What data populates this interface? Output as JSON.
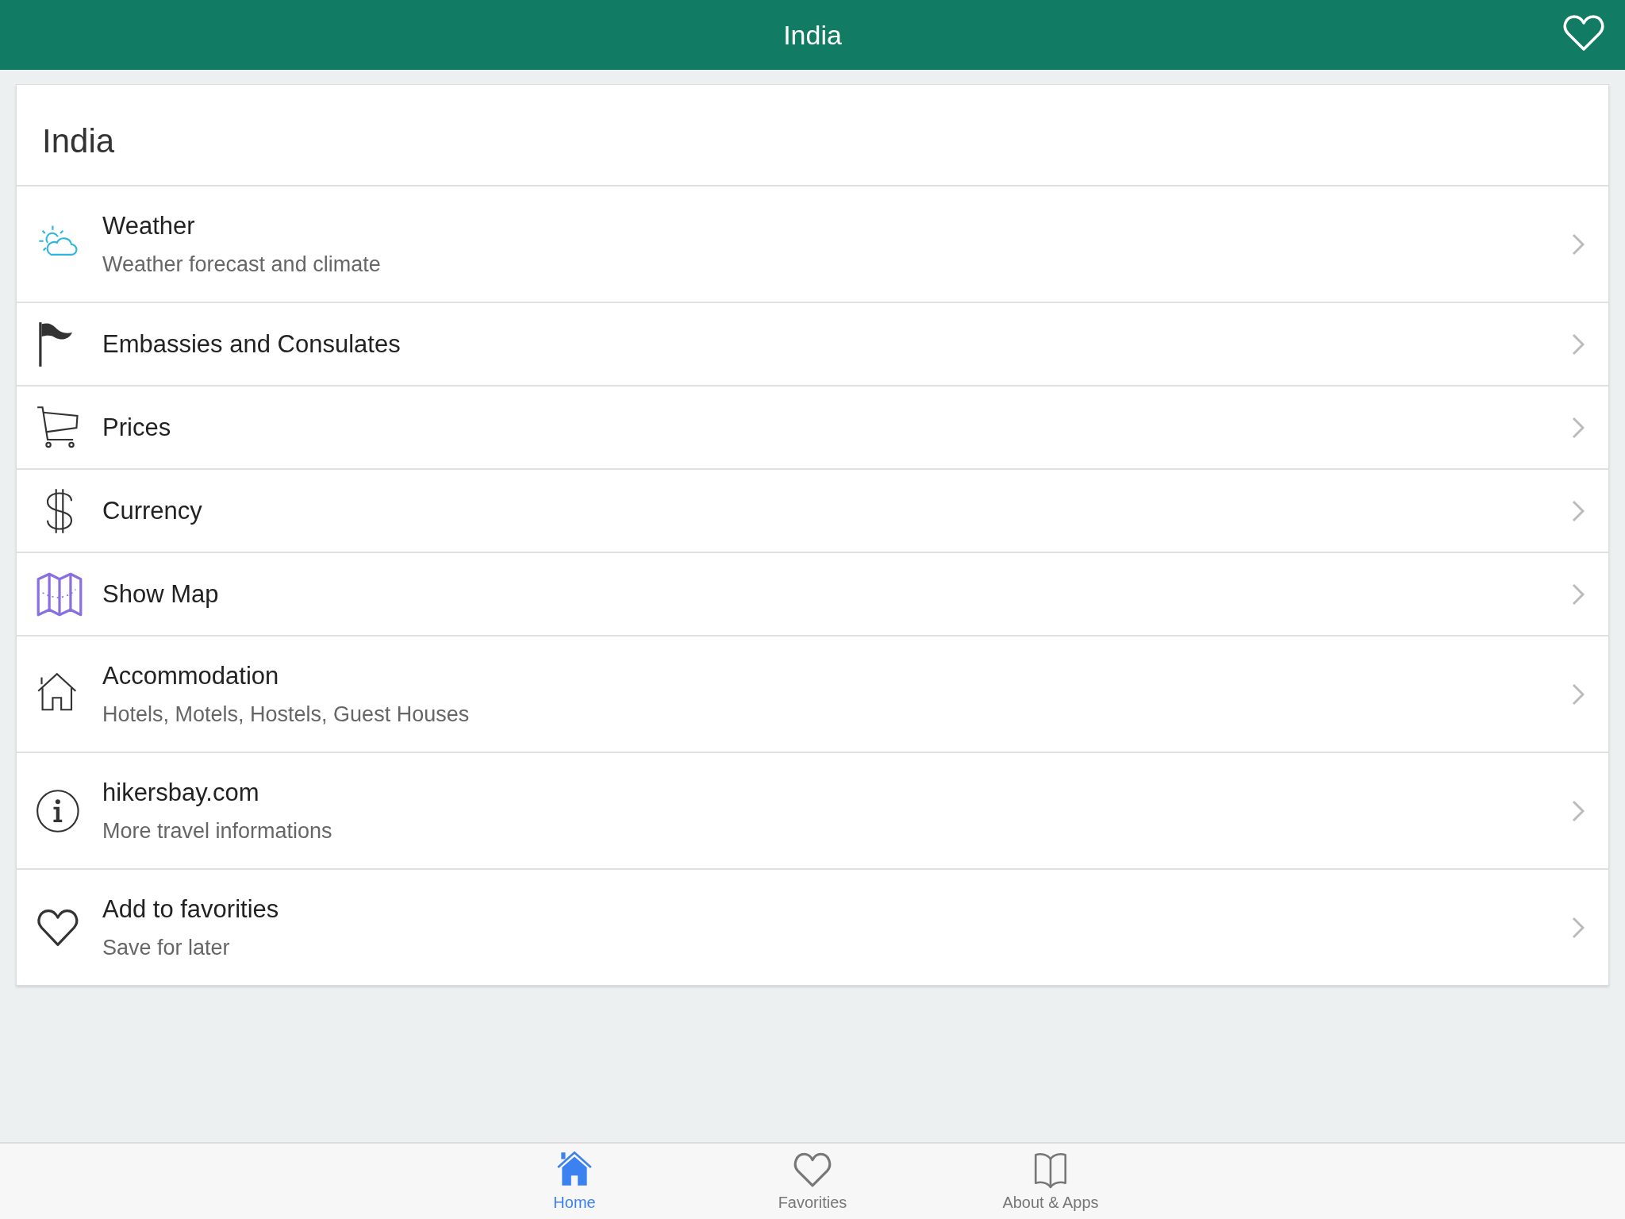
{
  "header": {
    "title": "India"
  },
  "card": {
    "title": "India",
    "items": [
      {
        "kind": "weather",
        "title": "Weather",
        "subtitle": "Weather forecast and climate"
      },
      {
        "kind": "flag",
        "title": "Embassies and Consulates"
      },
      {
        "kind": "cart",
        "title": "Prices"
      },
      {
        "kind": "dollar",
        "title": "Currency"
      },
      {
        "kind": "map",
        "title": "Show Map"
      },
      {
        "kind": "house",
        "title": "Accommodation",
        "subtitle": "Hotels, Motels, Hostels, Guest Houses"
      },
      {
        "kind": "info",
        "title": "hikersbay.com",
        "subtitle": "More travel informations"
      },
      {
        "kind": "heart",
        "title": "Add to favorities",
        "subtitle": "Save for later"
      }
    ]
  },
  "tab_bar": [
    {
      "kind": "home",
      "label": "Home",
      "selected": true
    },
    {
      "kind": "heart",
      "label": "Favorities",
      "selected": false
    },
    {
      "kind": "book",
      "label": "About & Apps",
      "selected": false
    }
  ]
}
